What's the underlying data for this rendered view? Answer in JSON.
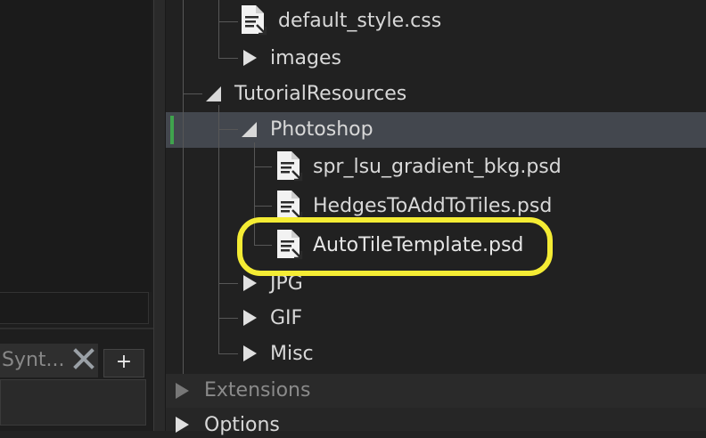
{
  "left_panel": {
    "syntax_tab_label": "Synt...",
    "add_tab_label": "+"
  },
  "tree": {
    "items": [
      {
        "label": "default_style.css",
        "kind": "file"
      },
      {
        "label": "images",
        "kind": "folder",
        "expanded": false
      },
      {
        "label": "TutorialResources",
        "kind": "folder",
        "expanded": true
      },
      {
        "label": "Photoshop",
        "kind": "folder",
        "expanded": true,
        "selected": true
      },
      {
        "label": "spr_lsu_gradient_bkg.psd",
        "kind": "file"
      },
      {
        "label": "HedgesToAddToTiles.psd",
        "kind": "file"
      },
      {
        "label": "AutoTileTemplate.psd",
        "kind": "file",
        "highlighted": true
      },
      {
        "label": "JPG",
        "kind": "folder",
        "expanded": false
      },
      {
        "label": "GIF",
        "kind": "folder",
        "expanded": false
      },
      {
        "label": "Misc",
        "kind": "folder",
        "expanded": false
      }
    ]
  },
  "sections": {
    "extensions_label": "Extensions",
    "options_label": "Options"
  },
  "colors": {
    "selection_row": "#43474e",
    "selection_marker": "#3fa34d",
    "highlight_ring": "#f4ec34"
  }
}
